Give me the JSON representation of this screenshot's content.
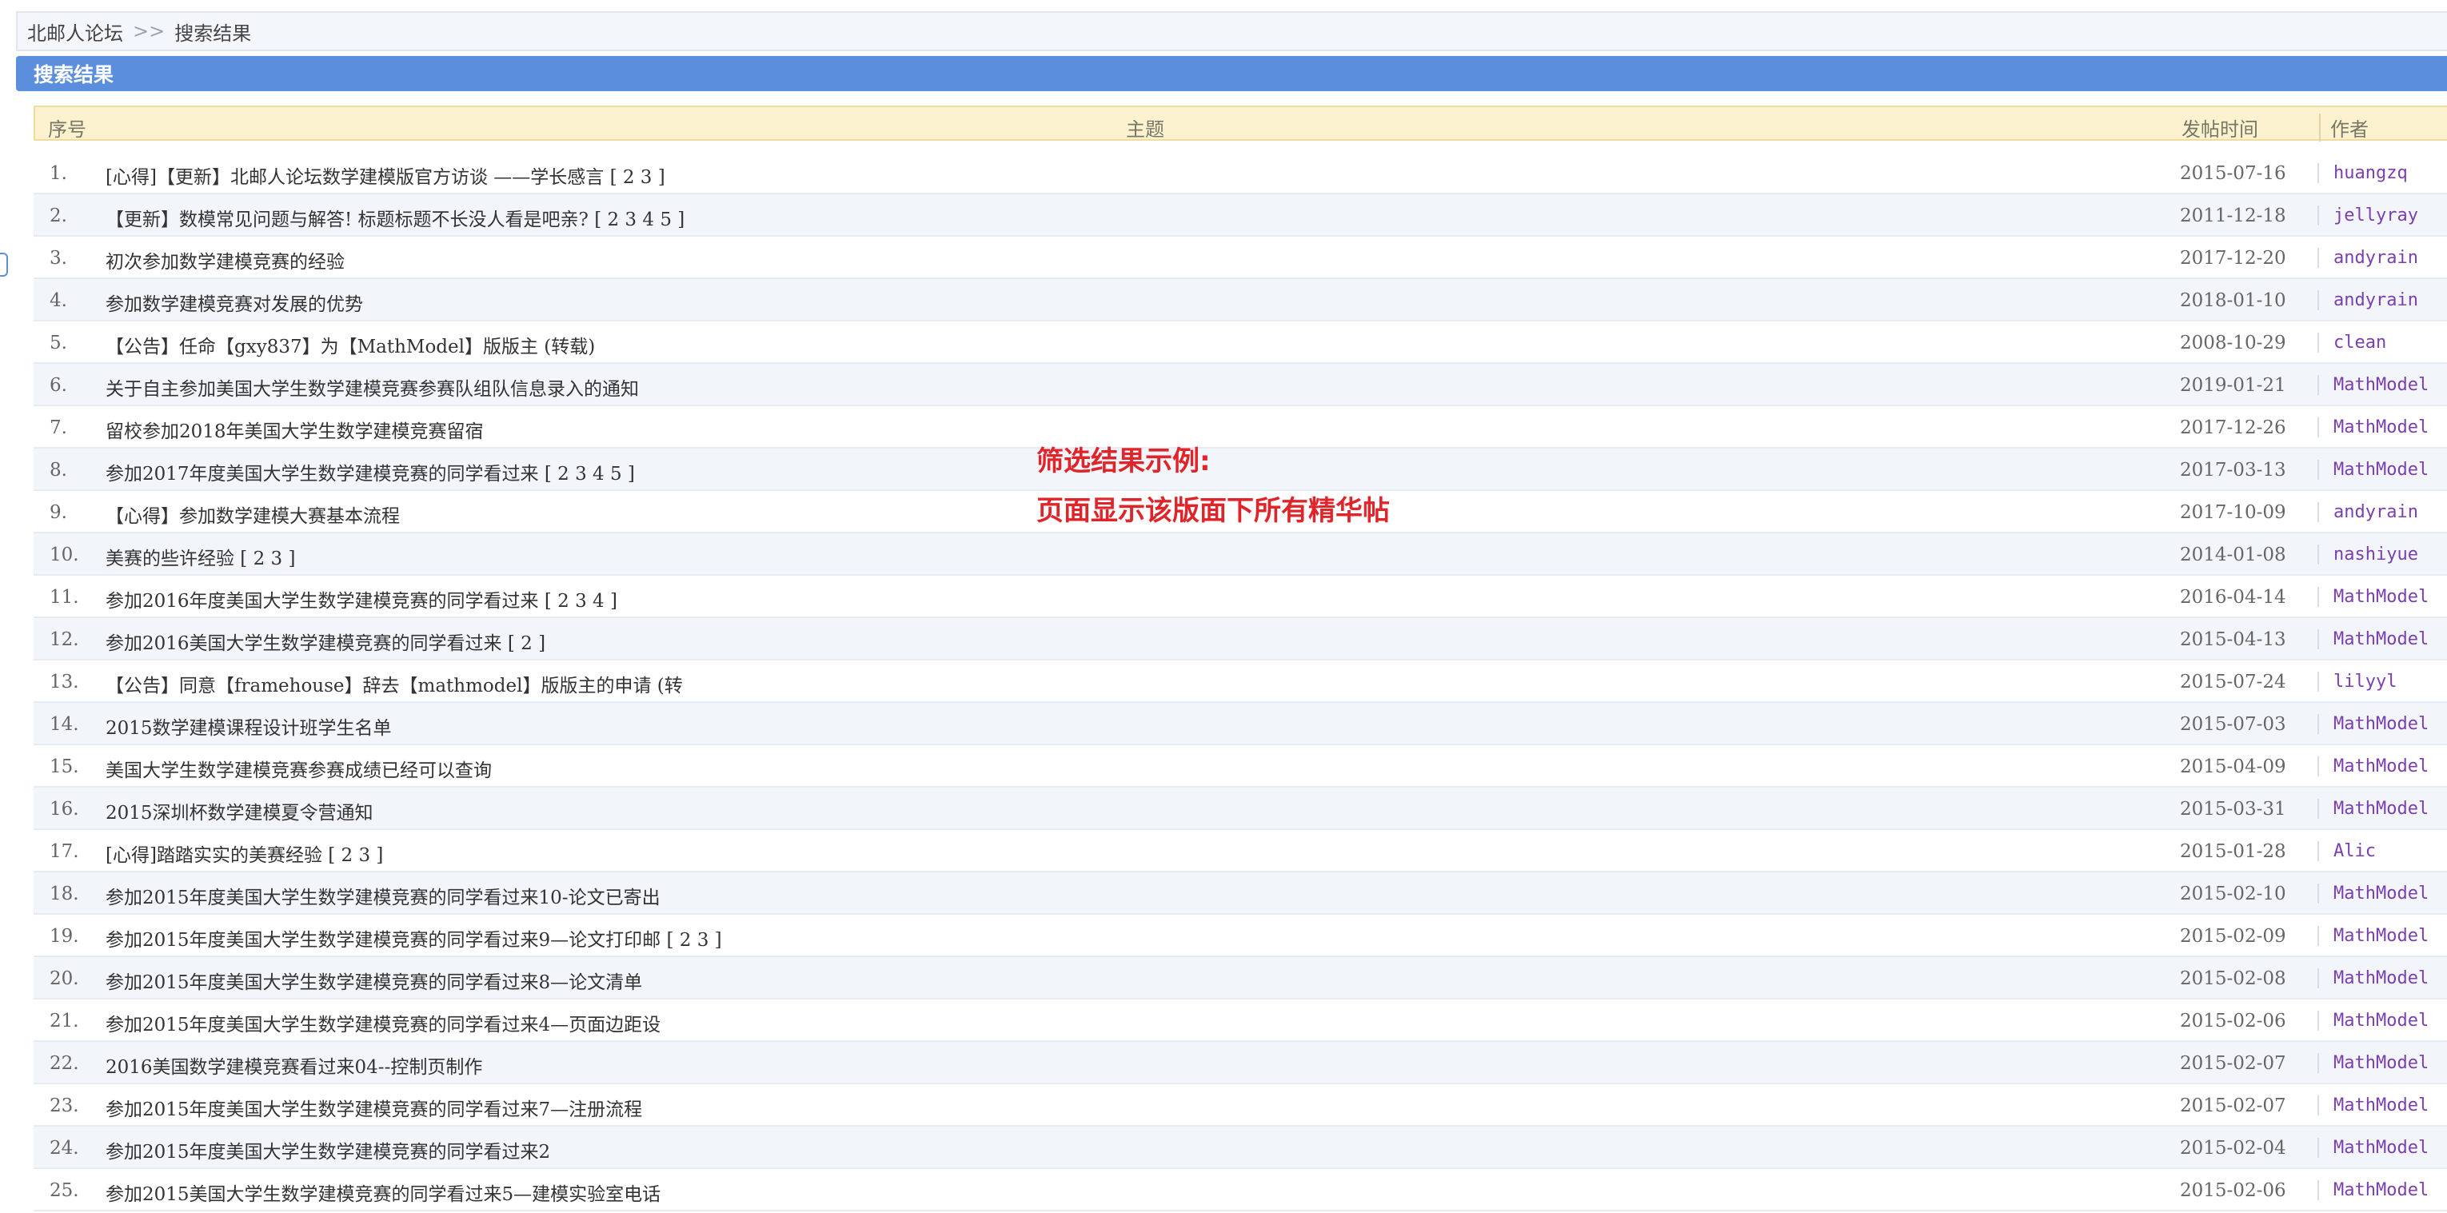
{
  "breadcrumb": {
    "forum": "北邮人论坛",
    "separator": ">>",
    "current": "搜索结果"
  },
  "title_bar": {
    "title": "搜索结果"
  },
  "table": {
    "headers": {
      "seq": "序号",
      "topic": "主题",
      "time": "发帖时间",
      "author": "作者"
    },
    "rows": [
      {
        "seq": "1.",
        "topic": "[心得]【更新】北邮人论坛数学建模版官方访谈 ——学长感言 [ 2 3 ]",
        "time": "2015-07-16",
        "author": "huangzq"
      },
      {
        "seq": "2.",
        "topic": "【更新】数模常见问题与解答! 标题标题不长没人看是吧亲? [ 2 3 4 5 ]",
        "time": "2011-12-18",
        "author": "jellyray"
      },
      {
        "seq": "3.",
        "topic": "初次参加数学建模竞赛的经验",
        "time": "2017-12-20",
        "author": "andyrain"
      },
      {
        "seq": "4.",
        "topic": "参加数学建模竞赛对发展的优势",
        "time": "2018-01-10",
        "author": "andyrain"
      },
      {
        "seq": "5.",
        "topic": "【公告】任命【gxy837】为【MathModel】版版主 (转载)",
        "time": "2008-10-29",
        "author": "clean"
      },
      {
        "seq": "6.",
        "topic": "关于自主参加美国大学生数学建模竞赛参赛队组队信息录入的通知",
        "time": "2019-01-21",
        "author": "MathModel"
      },
      {
        "seq": "7.",
        "topic": "留校参加2018年美国大学生数学建模竞赛留宿",
        "time": "2017-12-26",
        "author": "MathModel"
      },
      {
        "seq": "8.",
        "topic": "参加2017年度美国大学生数学建模竞赛的同学看过来 [ 2 3 4 5 ]",
        "time": "2017-03-13",
        "author": "MathModel"
      },
      {
        "seq": "9.",
        "topic": "【心得】参加数学建模大赛基本流程",
        "time": "2017-10-09",
        "author": "andyrain"
      },
      {
        "seq": "10.",
        "topic": "美赛的些许经验 [ 2 3 ]",
        "time": "2014-01-08",
        "author": "nashiyue"
      },
      {
        "seq": "11.",
        "topic": "参加2016年度美国大学生数学建模竞赛的同学看过来 [ 2 3 4 ]",
        "time": "2016-04-14",
        "author": "MathModel"
      },
      {
        "seq": "12.",
        "topic": "参加2016美国大学生数学建模竞赛的同学看过来 [ 2 ]",
        "time": "2015-04-13",
        "author": "MathModel"
      },
      {
        "seq": "13.",
        "topic": "【公告】同意【framehouse】辞去【mathmodel】版版主的申请 (转",
        "time": "2015-07-24",
        "author": "lilyyl"
      },
      {
        "seq": "14.",
        "topic": "2015数学建模课程设计班学生名单",
        "time": "2015-07-03",
        "author": "MathModel"
      },
      {
        "seq": "15.",
        "topic": "美国大学生数学建模竞赛参赛成绩已经可以查询",
        "time": "2015-04-09",
        "author": "MathModel"
      },
      {
        "seq": "16.",
        "topic": "2015深圳杯数学建模夏令营通知",
        "time": "2015-03-31",
        "author": "MathModel"
      },
      {
        "seq": "17.",
        "topic": "[心得]踏踏实实的美赛经验 [ 2 3 ]",
        "time": "2015-01-28",
        "author": "Alic"
      },
      {
        "seq": "18.",
        "topic": "参加2015年度美国大学生数学建模竞赛的同学看过来10-论文已寄出",
        "time": "2015-02-10",
        "author": "MathModel"
      },
      {
        "seq": "19.",
        "topic": "参加2015年度美国大学生数学建模竞赛的同学看过来9—论文打印邮 [ 2 3 ]",
        "time": "2015-02-09",
        "author": "MathModel"
      },
      {
        "seq": "20.",
        "topic": "参加2015年度美国大学生数学建模竞赛的同学看过来8—论文清单",
        "time": "2015-02-08",
        "author": "MathModel"
      },
      {
        "seq": "21.",
        "topic": "参加2015年度美国大学生数学建模竞赛的同学看过来4—页面边距设",
        "time": "2015-02-06",
        "author": "MathModel"
      },
      {
        "seq": "22.",
        "topic": "2016美国数学建模竞赛看过来04--控制页制作",
        "time": "2015-02-07",
        "author": "MathModel"
      },
      {
        "seq": "23.",
        "topic": "参加2015年度美国大学生数学建模竞赛的同学看过来7—注册流程",
        "time": "2015-02-07",
        "author": "MathModel"
      },
      {
        "seq": "24.",
        "topic": "参加2015年度美国大学生数学建模竞赛的同学看过来2",
        "time": "2015-02-04",
        "author": "MathModel"
      },
      {
        "seq": "25.",
        "topic": "参加2015美国大学生数学建模竞赛的同学看过来5—建模实验室电话",
        "time": "2015-02-06",
        "author": "MathModel"
      }
    ]
  },
  "annotation": {
    "line1": "筛选结果示例:",
    "line2": "页面显示该版面下所有精华帖"
  },
  "colors": {
    "title_bar": "#5b8fdd",
    "header_bg": "#fcf2cf",
    "author_link": "#7a3fb0",
    "annotation": "#e0252a"
  }
}
